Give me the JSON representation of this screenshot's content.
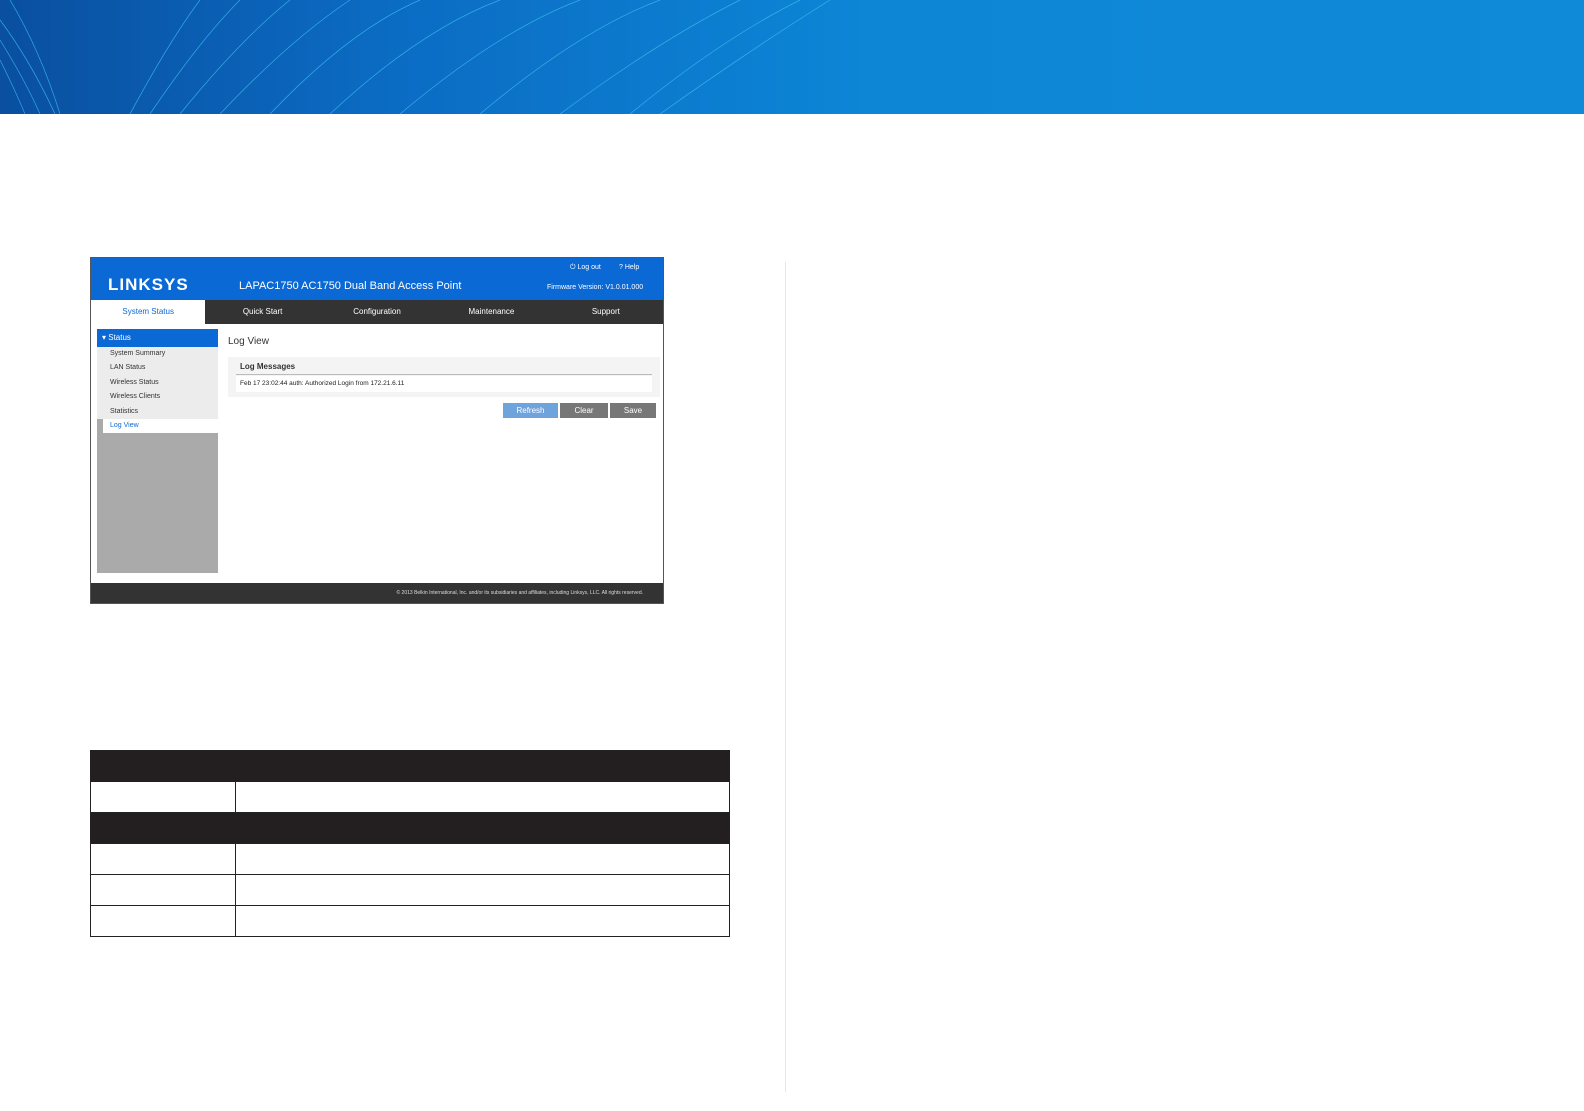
{
  "screenshot": {
    "logo": "LINKSYS",
    "product_title": "LAPAC1750 AC1750 Dual Band Access Point",
    "logout": "Log out",
    "help": "Help",
    "firmware": "Firmware Version: V1.0.01.000",
    "nav": [
      "System Status",
      "Quick Start",
      "Configuration",
      "Maintenance",
      "Support"
    ],
    "sidebar": {
      "header": "Status",
      "items": [
        "System Summary",
        "LAN Status",
        "Wireless Status",
        "Wireless Clients",
        "Statistics",
        "Log View"
      ]
    },
    "page_title": "Log View",
    "section": "Log Messages",
    "log_entry": "Feb 17 23:02:44 auth: Authorized Login from 172.21.6.11",
    "buttons": {
      "refresh": "Refresh",
      "clear": "Clear",
      "save": "Save"
    },
    "footer": "© 2013 Belkin International, Inc. and/or its subsidiaries and affiliates, including Linksys, LLC. All rights reserved.",
    "colors": {
      "brand": "#0b69d6",
      "dark": "#333333"
    }
  }
}
